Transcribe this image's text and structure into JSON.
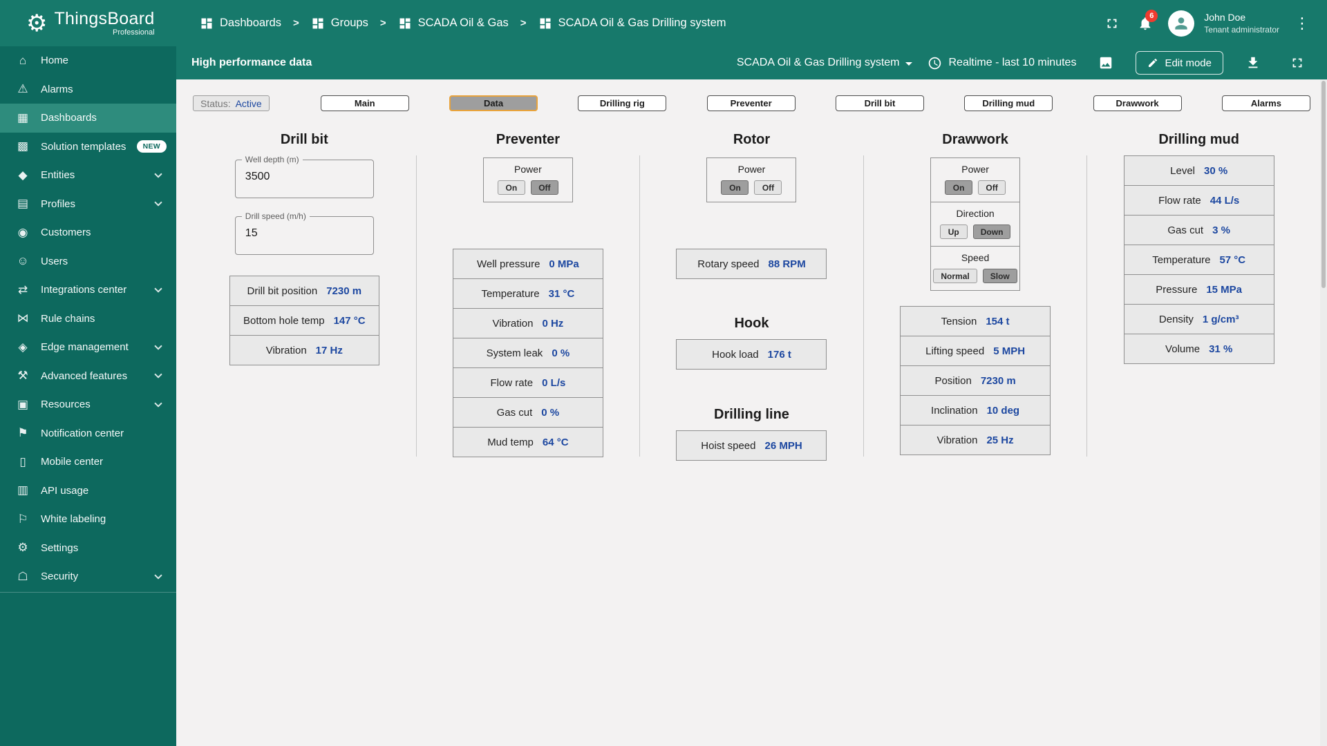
{
  "brand": {
    "name": "ThingsBoard",
    "edition": "Professional"
  },
  "icons": {
    "gear": "⚙",
    "kebab": "⋮"
  },
  "breadcrumb": {
    "sep": ">",
    "items": [
      {
        "label": "Dashboards"
      },
      {
        "label": "Groups"
      },
      {
        "label": "SCADA Oil & Gas"
      },
      {
        "label": "SCADA Oil & Gas Drilling system"
      }
    ]
  },
  "user": {
    "name": "John Doe",
    "role": "Tenant administrator",
    "notifications": "6"
  },
  "toolbar": {
    "title": "High performance data",
    "dashboard": "SCADA Oil & Gas Drilling system",
    "timewindow": "Realtime - last 10 minutes",
    "edit": "Edit mode"
  },
  "sidebar": {
    "items": [
      {
        "label": "Home",
        "glyph": "⌂"
      },
      {
        "label": "Alarms",
        "glyph": "⚠"
      },
      {
        "label": "Dashboards",
        "glyph": "▦"
      },
      {
        "label": "Solution templates",
        "glyph": "▩",
        "badge": "NEW"
      },
      {
        "label": "Entities",
        "glyph": "◆"
      },
      {
        "label": "Profiles",
        "glyph": "▤"
      },
      {
        "label": "Customers",
        "glyph": "◉"
      },
      {
        "label": "Users",
        "glyph": "☺"
      },
      {
        "label": "Integrations center",
        "glyph": "⇄"
      },
      {
        "label": "Rule chains",
        "glyph": "⋈"
      },
      {
        "label": "Edge management",
        "glyph": "◈"
      },
      {
        "label": "Advanced features",
        "glyph": "⚒"
      },
      {
        "label": "Resources",
        "glyph": "▣"
      },
      {
        "label": "Notification center",
        "glyph": "⚑"
      },
      {
        "label": "Mobile center",
        "glyph": "▯"
      },
      {
        "label": "API usage",
        "glyph": "▥"
      },
      {
        "label": "White labeling",
        "glyph": "⚐"
      },
      {
        "label": "Settings",
        "glyph": "⚙"
      },
      {
        "label": "Security",
        "glyph": "☖"
      }
    ]
  },
  "status": {
    "label": "Status:",
    "value": "Active"
  },
  "tabs": [
    {
      "label": "Main"
    },
    {
      "label": "Data"
    },
    {
      "label": "Drilling rig"
    },
    {
      "label": "Preventer"
    },
    {
      "label": "Drill bit"
    },
    {
      "label": "Drilling mud"
    },
    {
      "label": "Drawwork"
    },
    {
      "label": "Alarms"
    }
  ],
  "drill_bit": {
    "title": "Drill bit",
    "well_depth": {
      "label": "Well depth (m)",
      "value": "3500"
    },
    "drill_speed": {
      "label": "Drill speed (m/h)",
      "value": "15"
    },
    "rows": [
      {
        "label": "Drill bit position",
        "value": "7230 m"
      },
      {
        "label": "Bottom hole temp",
        "value": "147 °C"
      },
      {
        "label": "Vibration",
        "value": "17 Hz"
      }
    ]
  },
  "preventer": {
    "title": "Preventer",
    "power": {
      "label": "Power",
      "on": "On",
      "off": "Off",
      "selected": "Off"
    },
    "rows": [
      {
        "label": "Well pressure",
        "value": "0 MPa"
      },
      {
        "label": "Temperature",
        "value": "31 °C"
      },
      {
        "label": "Vibration",
        "value": "0 Hz"
      },
      {
        "label": "System leak",
        "value": "0 %"
      },
      {
        "label": "Flow rate",
        "value": "0 L/s"
      },
      {
        "label": "Gas cut",
        "value": "0 %"
      },
      {
        "label": "Mud temp",
        "value": "64 °C"
      }
    ]
  },
  "rotor": {
    "title": "Rotor",
    "power": {
      "label": "Power",
      "on": "On",
      "off": "Off",
      "selected": "On"
    },
    "rows": [
      {
        "label": "Rotary speed",
        "value": "88 RPM"
      }
    ],
    "hook": {
      "title": "Hook",
      "rows": [
        {
          "label": "Hook load",
          "value": "176 t"
        }
      ]
    },
    "drilling_line": {
      "title": "Drilling line",
      "rows": [
        {
          "label": "Hoist speed",
          "value": "26 MPH"
        }
      ]
    }
  },
  "drawwork": {
    "title": "Drawwork",
    "power": {
      "label": "Power",
      "on": "On",
      "off": "Off",
      "selected": "On"
    },
    "direction": {
      "label": "Direction",
      "up": "Up",
      "down": "Down",
      "selected": "Down"
    },
    "speed": {
      "label": "Speed",
      "normal": "Normal",
      "slow": "Slow",
      "selected": "Slow"
    },
    "rows": [
      {
        "label": "Tension",
        "value": "154 t"
      },
      {
        "label": "Lifting speed",
        "value": "5 MPH"
      },
      {
        "label": "Position",
        "value": "7230 m"
      },
      {
        "label": "Inclination",
        "value": "10 deg"
      },
      {
        "label": "Vibration",
        "value": "25 Hz"
      }
    ]
  },
  "drilling_mud": {
    "title": "Drilling mud",
    "rows": [
      {
        "label": "Level",
        "value": "30 %"
      },
      {
        "label": "Flow rate",
        "value": "44 L/s"
      },
      {
        "label": "Gas cut",
        "value": "3 %"
      },
      {
        "label": "Temperature",
        "value": "57 °C"
      },
      {
        "label": "Pressure",
        "value": "15 MPa"
      },
      {
        "label": "Density",
        "value": "1 g/cm³"
      },
      {
        "label": "Volume",
        "value": "31 %"
      }
    ]
  }
}
